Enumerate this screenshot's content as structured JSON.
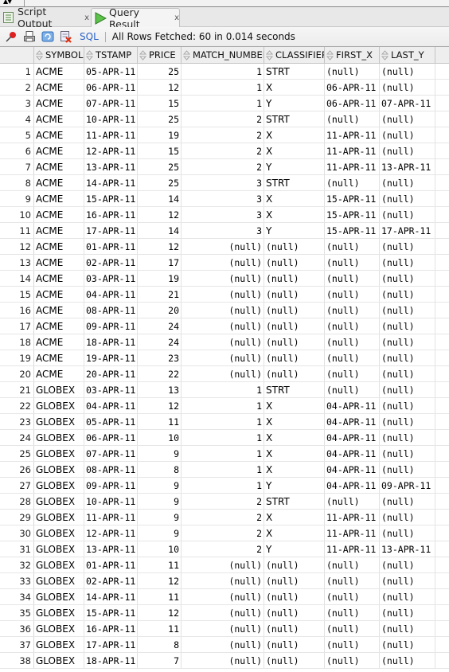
{
  "tabs": [
    {
      "label": "Script Output",
      "icon": "script-output-icon",
      "active": false
    },
    {
      "label": "Query Result",
      "icon": "run-triangle-icon",
      "active": true
    }
  ],
  "toolbar": {
    "icons": [
      "pin-icon",
      "print-icon",
      "refresh-icon",
      "clear-icon"
    ],
    "sql_label": "SQL",
    "status": "All Rows Fetched: 60 in 0.014 seconds"
  },
  "colors": {
    "sql_link": "#2a62c7",
    "header_bg": "#eeeeee",
    "grid_line": "#e2e2e2"
  },
  "table": {
    "columns": [
      "SYMBOL",
      "TSTAMP",
      "PRICE",
      "MATCH_NUMBER",
      "CLASSIFIER",
      "FIRST_X",
      "LAST_Y"
    ],
    "rows": [
      [
        "1",
        "ACME",
        "05-APR-11",
        "25",
        "1",
        "STRT",
        "(null)",
        "(null)"
      ],
      [
        "2",
        "ACME",
        "06-APR-11",
        "12",
        "1",
        "X",
        "06-APR-11",
        "(null)"
      ],
      [
        "3",
        "ACME",
        "07-APR-11",
        "15",
        "1",
        "Y",
        "06-APR-11",
        "07-APR-11"
      ],
      [
        "4",
        "ACME",
        "10-APR-11",
        "25",
        "2",
        "STRT",
        "(null)",
        "(null)"
      ],
      [
        "5",
        "ACME",
        "11-APR-11",
        "19",
        "2",
        "X",
        "11-APR-11",
        "(null)"
      ],
      [
        "6",
        "ACME",
        "12-APR-11",
        "15",
        "2",
        "X",
        "11-APR-11",
        "(null)"
      ],
      [
        "7",
        "ACME",
        "13-APR-11",
        "25",
        "2",
        "Y",
        "11-APR-11",
        "13-APR-11"
      ],
      [
        "8",
        "ACME",
        "14-APR-11",
        "25",
        "3",
        "STRT",
        "(null)",
        "(null)"
      ],
      [
        "9",
        "ACME",
        "15-APR-11",
        "14",
        "3",
        "X",
        "15-APR-11",
        "(null)"
      ],
      [
        "10",
        "ACME",
        "16-APR-11",
        "12",
        "3",
        "X",
        "15-APR-11",
        "(null)"
      ],
      [
        "11",
        "ACME",
        "17-APR-11",
        "14",
        "3",
        "Y",
        "15-APR-11",
        "17-APR-11"
      ],
      [
        "12",
        "ACME",
        "01-APR-11",
        "12",
        "(null)",
        "(null)",
        "(null)",
        "(null)"
      ],
      [
        "13",
        "ACME",
        "02-APR-11",
        "17",
        "(null)",
        "(null)",
        "(null)",
        "(null)"
      ],
      [
        "14",
        "ACME",
        "03-APR-11",
        "19",
        "(null)",
        "(null)",
        "(null)",
        "(null)"
      ],
      [
        "15",
        "ACME",
        "04-APR-11",
        "21",
        "(null)",
        "(null)",
        "(null)",
        "(null)"
      ],
      [
        "16",
        "ACME",
        "08-APR-11",
        "20",
        "(null)",
        "(null)",
        "(null)",
        "(null)"
      ],
      [
        "17",
        "ACME",
        "09-APR-11",
        "24",
        "(null)",
        "(null)",
        "(null)",
        "(null)"
      ],
      [
        "18",
        "ACME",
        "18-APR-11",
        "24",
        "(null)",
        "(null)",
        "(null)",
        "(null)"
      ],
      [
        "19",
        "ACME",
        "19-APR-11",
        "23",
        "(null)",
        "(null)",
        "(null)",
        "(null)"
      ],
      [
        "20",
        "ACME",
        "20-APR-11",
        "22",
        "(null)",
        "(null)",
        "(null)",
        "(null)"
      ],
      [
        "21",
        "GLOBEX",
        "03-APR-11",
        "13",
        "1",
        "STRT",
        "(null)",
        "(null)"
      ],
      [
        "22",
        "GLOBEX",
        "04-APR-11",
        "12",
        "1",
        "X",
        "04-APR-11",
        "(null)"
      ],
      [
        "23",
        "GLOBEX",
        "05-APR-11",
        "11",
        "1",
        "X",
        "04-APR-11",
        "(null)"
      ],
      [
        "24",
        "GLOBEX",
        "06-APR-11",
        "10",
        "1",
        "X",
        "04-APR-11",
        "(null)"
      ],
      [
        "25",
        "GLOBEX",
        "07-APR-11",
        "9",
        "1",
        "X",
        "04-APR-11",
        "(null)"
      ],
      [
        "26",
        "GLOBEX",
        "08-APR-11",
        "8",
        "1",
        "X",
        "04-APR-11",
        "(null)"
      ],
      [
        "27",
        "GLOBEX",
        "09-APR-11",
        "9",
        "1",
        "Y",
        "04-APR-11",
        "09-APR-11"
      ],
      [
        "28",
        "GLOBEX",
        "10-APR-11",
        "9",
        "2",
        "STRT",
        "(null)",
        "(null)"
      ],
      [
        "29",
        "GLOBEX",
        "11-APR-11",
        "9",
        "2",
        "X",
        "11-APR-11",
        "(null)"
      ],
      [
        "30",
        "GLOBEX",
        "12-APR-11",
        "9",
        "2",
        "X",
        "11-APR-11",
        "(null)"
      ],
      [
        "31",
        "GLOBEX",
        "13-APR-11",
        "10",
        "2",
        "Y",
        "11-APR-11",
        "13-APR-11"
      ],
      [
        "32",
        "GLOBEX",
        "01-APR-11",
        "11",
        "(null)",
        "(null)",
        "(null)",
        "(null)"
      ],
      [
        "33",
        "GLOBEX",
        "02-APR-11",
        "12",
        "(null)",
        "(null)",
        "(null)",
        "(null)"
      ],
      [
        "34",
        "GLOBEX",
        "14-APR-11",
        "11",
        "(null)",
        "(null)",
        "(null)",
        "(null)"
      ],
      [
        "35",
        "GLOBEX",
        "15-APR-11",
        "12",
        "(null)",
        "(null)",
        "(null)",
        "(null)"
      ],
      [
        "36",
        "GLOBEX",
        "16-APR-11",
        "11",
        "(null)",
        "(null)",
        "(null)",
        "(null)"
      ],
      [
        "37",
        "GLOBEX",
        "17-APR-11",
        "8",
        "(null)",
        "(null)",
        "(null)",
        "(null)"
      ],
      [
        "38",
        "GLOBEX",
        "18-APR-11",
        "7",
        "(null)",
        "(null)",
        "(null)",
        "(null)"
      ]
    ]
  }
}
